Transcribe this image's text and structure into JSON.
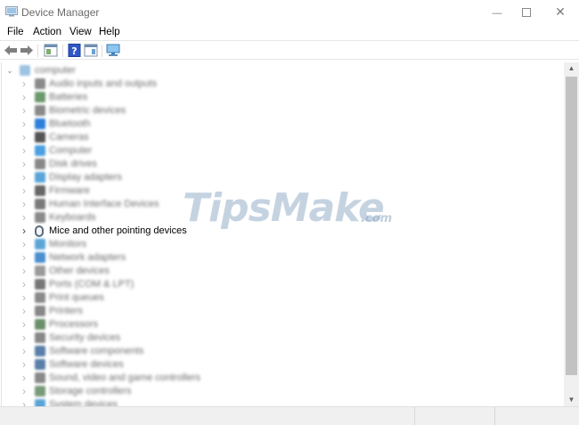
{
  "window": {
    "title": "Device Manager",
    "controls": {
      "minimize": "—",
      "close": "✕"
    }
  },
  "menu": [
    "File",
    "Action",
    "View",
    "Help"
  ],
  "toolbar": {
    "buttons": [
      "back-arrow-icon",
      "forward-arrow-icon",
      "properties-icon",
      "help-icon",
      "action-icon",
      "monitor-icon"
    ]
  },
  "tree": {
    "root": "computer",
    "categories": [
      {
        "label": "Audio inputs and outputs",
        "color": "#8a8a8a",
        "blurred": true
      },
      {
        "label": "Batteries",
        "color": "#6c9a6c",
        "blurred": true
      },
      {
        "label": "Biometric devices",
        "color": "#8a8a8a",
        "blurred": true
      },
      {
        "label": "Bluetooth",
        "color": "#2e7fd9",
        "blurred": true
      },
      {
        "label": "Cameras",
        "color": "#555555",
        "blurred": true
      },
      {
        "label": "Computer",
        "color": "#4aa0e0",
        "blurred": true
      },
      {
        "label": "Disk drives",
        "color": "#888888",
        "blurred": true
      },
      {
        "label": "Display adapters",
        "color": "#5aa5d8",
        "blurred": true
      },
      {
        "label": "Firmware",
        "color": "#666666",
        "blurred": true
      },
      {
        "label": "Human Interface Devices",
        "color": "#7a7a7a",
        "blurred": true
      },
      {
        "label": "Keyboards",
        "color": "#8a8a8a",
        "blurred": true
      },
      {
        "label": "Mice and other pointing devices",
        "color": "#5a6b7c",
        "blurred": false
      },
      {
        "label": "Monitors",
        "color": "#5aa5d8",
        "blurred": true
      },
      {
        "label": "Network adapters",
        "color": "#4b8fcf",
        "blurred": true
      },
      {
        "label": "Other devices",
        "color": "#9a9a9a",
        "blurred": true
      },
      {
        "label": "Ports (COM & LPT)",
        "color": "#777777",
        "blurred": true
      },
      {
        "label": "Print queues",
        "color": "#8a8a8a",
        "blurred": true
      },
      {
        "label": "Printers",
        "color": "#888888",
        "blurred": true
      },
      {
        "label": "Processors",
        "color": "#6b8e6b",
        "blurred": true
      },
      {
        "label": "Security devices",
        "color": "#888888",
        "blurred": true
      },
      {
        "label": "Software components",
        "color": "#5a7fa8",
        "blurred": true
      },
      {
        "label": "Software devices",
        "color": "#5a7fa8",
        "blurred": true
      },
      {
        "label": "Sound, video and game controllers",
        "color": "#8a8a8a",
        "blurred": true
      },
      {
        "label": "Storage controllers",
        "color": "#7a9a7a",
        "blurred": true
      },
      {
        "label": "System devices",
        "color": "#5aa5d8",
        "blurred": true
      }
    ]
  },
  "watermark": {
    "text": "TipsMake",
    "suffix": ".com"
  }
}
